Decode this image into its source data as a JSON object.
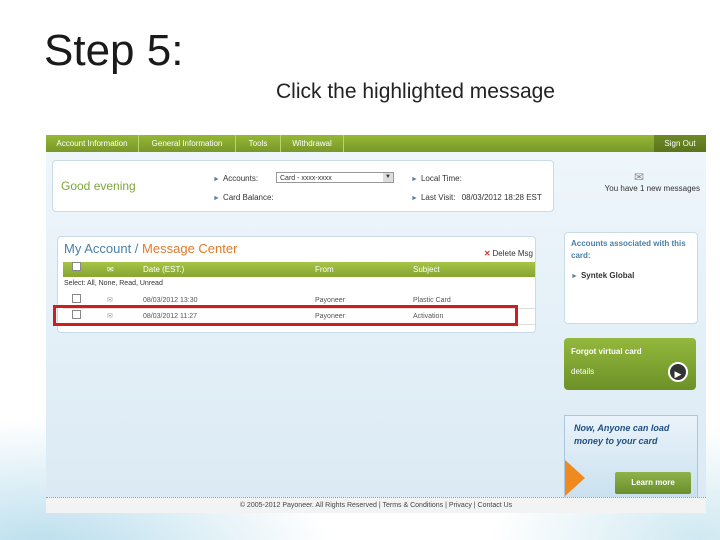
{
  "slide": {
    "title": "Step 5:",
    "subtitle": "Click the highlighted message"
  },
  "nav": {
    "tabs": [
      "Account Information",
      "General Information",
      "Tools",
      "Withdrawal"
    ],
    "sign_out": "Sign Out"
  },
  "welcome": {
    "greeting": "Good evening",
    "accounts_label": "Accounts:",
    "accounts_value": "Card - xxxx-xxxx",
    "card_balance_label": "Card Balance:",
    "local_time_label": "Local Time:",
    "last_visit_label": "Last Visit:",
    "last_visit_value": "08/03/2012 18:28 EST",
    "new_messages": "You have 1 new messages"
  },
  "message_center": {
    "title_a": "My Account /",
    "title_b": "Message Center",
    "delete_label": "Delete Msg",
    "columns": [
      "Date (EST.)",
      "From",
      "Subject"
    ],
    "select_line": "Select: All, None, Read, Unread",
    "rows": [
      {
        "date": "08/03/2012 13:30",
        "from": "Payoneer",
        "subject": "Plastic Card"
      },
      {
        "date": "08/03/2012 11:27",
        "from": "Payoneer",
        "subject": "Activation"
      }
    ]
  },
  "sidebar": {
    "accounts_heading": "Accounts associated with this card:",
    "account_item": "Syntek Global",
    "forgot_title": "Forgot virtual card",
    "forgot_details": "details",
    "anyone_text": "Now, Anyone can load money to your card",
    "learn_more": "Learn more"
  },
  "footer": {
    "text": "© 2005-2012 Payoneer. All Rights Reserved | Terms & Conditions | Privacy | Contact Us"
  },
  "colors": {
    "nav_green": "#86a532",
    "highlight_red": "#cc2020",
    "title_blue": "#4b7fa8",
    "title_orange": "#e07a2c"
  }
}
